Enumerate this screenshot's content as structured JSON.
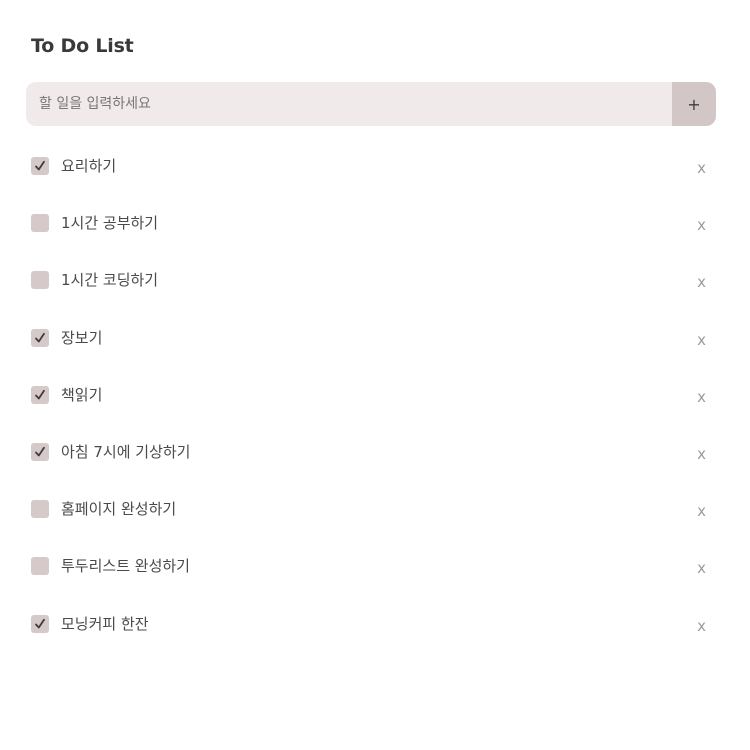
{
  "app": {
    "title": "To Do List"
  },
  "input": {
    "placeholder": "할 일을 입력하세요",
    "value": "",
    "add_label": "+"
  },
  "todos": [
    {
      "text": "요리하기",
      "done": true,
      "delete_label": "x"
    },
    {
      "text": "1시간 공부하기",
      "done": false,
      "delete_label": "x"
    },
    {
      "text": "1시간 코딩하기",
      "done": false,
      "delete_label": "x"
    },
    {
      "text": "장보기",
      "done": true,
      "delete_label": "x"
    },
    {
      "text": "책읽기",
      "done": true,
      "delete_label": "x"
    },
    {
      "text": "아침 7시에 기상하기",
      "done": true,
      "delete_label": "x"
    },
    {
      "text": "홈페이지 완성하기",
      "done": false,
      "delete_label": "x"
    },
    {
      "text": "투두리스트 완성하기",
      "done": false,
      "delete_label": "x"
    },
    {
      "text": "모닝커피 한잔",
      "done": true,
      "delete_label": "x"
    }
  ],
  "colors": {
    "input_bg": "#f0eaea",
    "add_button_bg": "#d3c6c6",
    "checkbox_bg": "#d6c9c9",
    "checkmark": "#3d3d3d",
    "delete_color": "#9b9b9b"
  }
}
